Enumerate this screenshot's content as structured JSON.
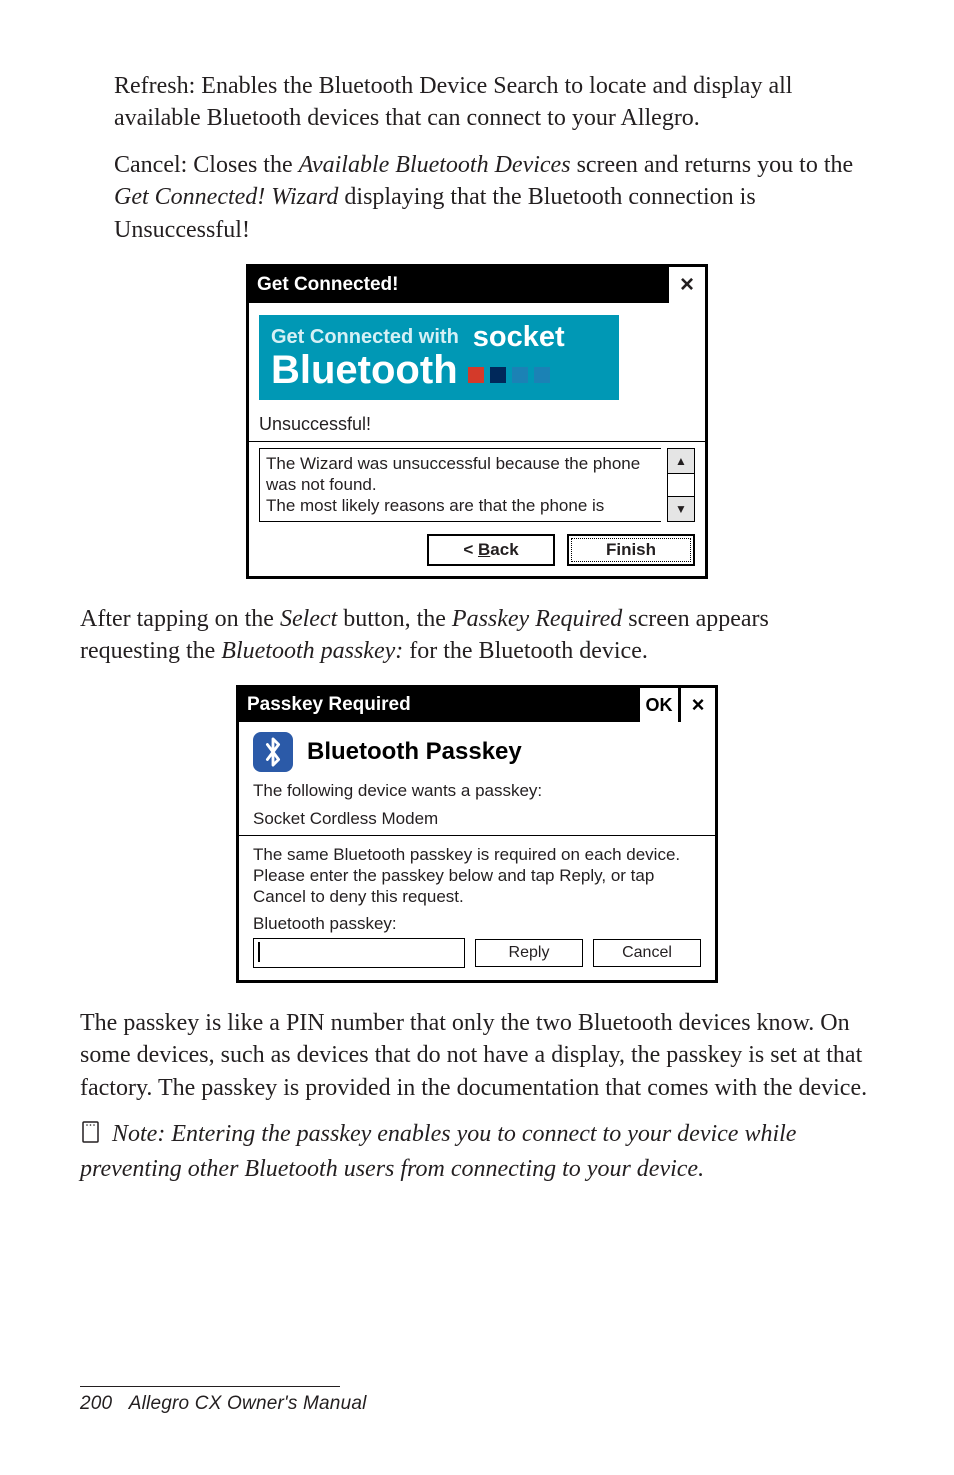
{
  "paragraphs": {
    "p1a": "Refresh: Enables the Bluetooth Device Search to locate and display all available Bluetooth devices that can connect to your Allegro.",
    "p2_pre": "Cancel: Closes the ",
    "p2_i1": "Available Bluetooth Devices",
    "p2_mid": " screen and returns you to the ",
    "p2_i2": "Get Connected! Wizard",
    "p2_post": " displaying that the Bluetooth connection is Unsuccessful!",
    "p3_pre": "After tapping on the ",
    "p3_i1": "Select",
    "p3_mid1": " button, the ",
    "p3_i2": "Passkey Required",
    "p3_mid2": " screen appears requesting the ",
    "p3_i3": "Bluetooth passkey:",
    "p3_post": " for the Bluetooth device.",
    "p4": "The passkey is like a PIN number that only the two Bluetooth devices know. On some devices, such as devices that do not have a display, the passkey is set at that factory. The passkey is provided in the documentation that comes with the device.",
    "note": "Note: Entering the passkey enables you to connect to your device while preventing other Bluetooth users from connecting to your device."
  },
  "dlg1": {
    "title": "Get Connected!",
    "close": "×",
    "banner_gcw": "Get Connected with",
    "banner_socket": "socket",
    "banner_bt": "Bluetooth",
    "unsuccess": "Unsuccessful!",
    "msg": "The Wizard was unsuccessful because the phone was not found.\nThe most likely reasons are that the phone is",
    "back_lt": "< ",
    "back_u": "B",
    "back_rest": "ack",
    "finish": "Finish"
  },
  "dlg2": {
    "title": "Passkey Required",
    "ok": "OK",
    "close": "×",
    "heading": "Bluetooth Passkey",
    "line1": "The following device wants a passkey:",
    "line2": "Socket Cordless Modem",
    "para": "The same Bluetooth passkey is required on each device. Please enter the passkey below and tap Reply, or tap Cancel to deny this request.",
    "label": "Bluetooth passkey:",
    "reply": "Reply",
    "cancel": "Cancel"
  },
  "footer": {
    "page_no": "200",
    "title": "Allegro CX Owner's Manual"
  }
}
